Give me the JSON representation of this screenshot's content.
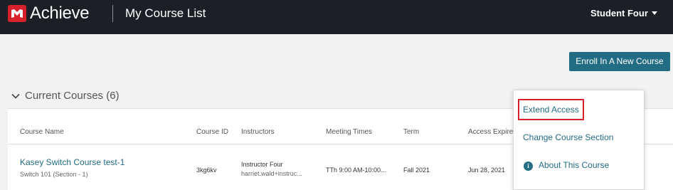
{
  "header": {
    "brand": "Achieve",
    "page_title": "My Course List",
    "user_name": "Student Four"
  },
  "actions": {
    "enroll_label": "Enroll In A New Course"
  },
  "section": {
    "title": "Current Courses (6)"
  },
  "table": {
    "columns": [
      "Course Name",
      "Course ID",
      "Instructors",
      "Meeting Times",
      "Term",
      "Access Expires"
    ],
    "rows": [
      {
        "course_name": "Kasey Switch Course test-1",
        "course_sub": "Switch 101 (Section - 1)",
        "course_id": "3kg6kv",
        "instructor_name": "Instructor Four",
        "instructor_email": "harriet.wald+instruc...",
        "meeting_times": "TTh 9:00 AM-10:00...",
        "term": "Fall 2021",
        "access_expires": "Jun 28, 2021"
      }
    ]
  },
  "course_menu": {
    "extend_access": "Extend Access",
    "change_section": "Change Course Section",
    "about_course": "About This Course"
  },
  "colors": {
    "accent": "#236d84",
    "brand_red": "#d6202a",
    "topbar": "#1c1f26"
  }
}
